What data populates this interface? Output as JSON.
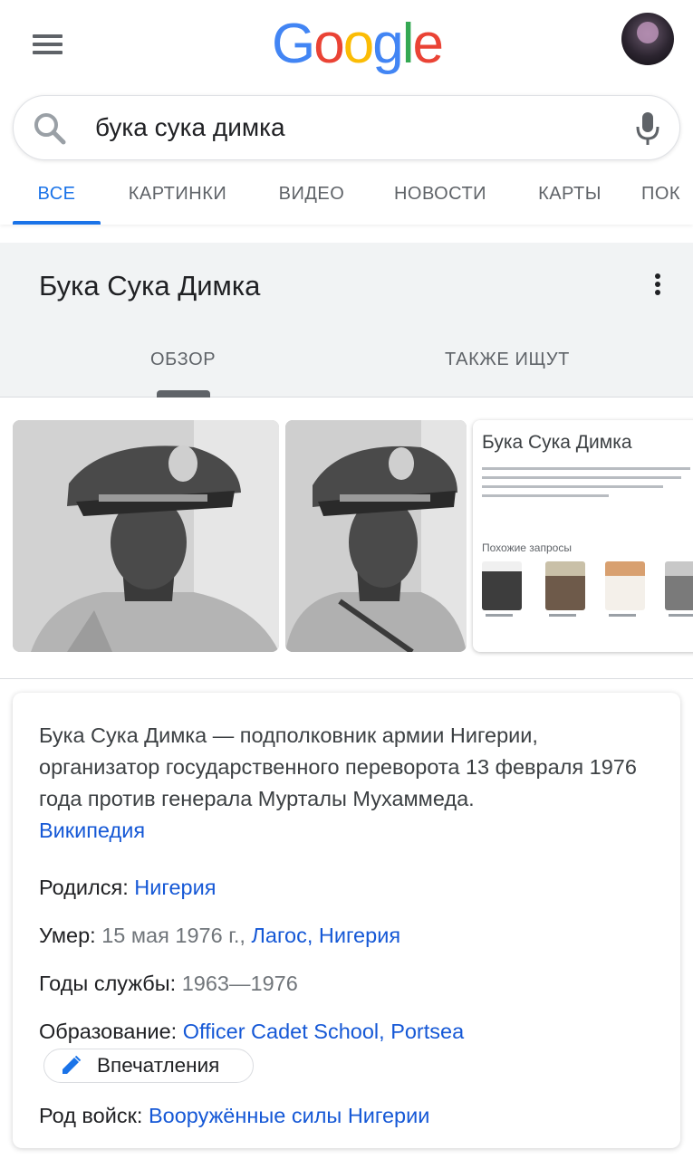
{
  "header": {
    "logo_letters": [
      {
        "ch": "G",
        "color": "#4285f4"
      },
      {
        "ch": "o",
        "color": "#ea4335"
      },
      {
        "ch": "o",
        "color": "#fbbc05"
      },
      {
        "ch": "g",
        "color": "#4285f4"
      },
      {
        "ch": "l",
        "color": "#34a853"
      },
      {
        "ch": "e",
        "color": "#ea4335"
      }
    ],
    "menu_icon": "hamburger-menu-icon",
    "avatar_icon": "user-avatar"
  },
  "search": {
    "query": "бука сука димка",
    "search_icon": "search-icon",
    "mic_icon": "mic-icon"
  },
  "tabs": [
    {
      "label": "ВСЕ",
      "active": true
    },
    {
      "label": "КАРТИНКИ"
    },
    {
      "label": "ВИДЕО"
    },
    {
      "label": "НОВОСТИ"
    },
    {
      "label": "КАРТЫ"
    },
    {
      "label": "ПОК"
    }
  ],
  "knowledge_panel": {
    "title": "Бука Сука Димка",
    "tabs": [
      "ОБЗОР",
      "ТАКЖЕ ИЩУТ"
    ],
    "active_tab": "ОБЗОР"
  },
  "thumbnail_card": {
    "title": "Бука Сука Димка",
    "related_heading": "Похожие запросы"
  },
  "description": {
    "text": "Бука Сука Димка — подполковник армии Нигерии, организатор государственного переворота 13 февраля 1976 года против генерала Мурталы Мухаммеда.",
    "source_link": "Википедия"
  },
  "facts": {
    "born": {
      "label": "Родился:",
      "link": "Нигерия"
    },
    "died": {
      "label": "Умер:",
      "value": "15 мая 1976 г.,",
      "link": "Лагос, Нигерия"
    },
    "service_years": {
      "label": "Годы службы:",
      "value": "1963—1976"
    },
    "education": {
      "label": "Образование:",
      "link": "Officer Cadet School, Portsea"
    },
    "feedback_button": "Впечатления",
    "branch": {
      "label": "Род войск:",
      "link": "Вооружённые силы Нигерии"
    }
  },
  "colors": {
    "accent_blue": "#1a73e8",
    "link_blue": "#1558d6",
    "panel_gray": "#f1f3f4"
  }
}
